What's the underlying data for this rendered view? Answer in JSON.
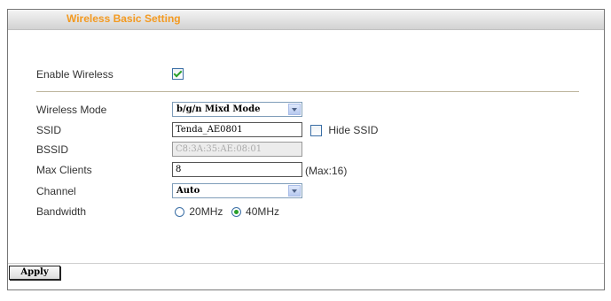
{
  "page": {
    "title": "Wireless Basic Setting"
  },
  "enable_wireless": {
    "label": "Enable Wireless",
    "checked": true
  },
  "wireless_mode": {
    "label": "Wireless Mode",
    "value": "b/g/n Mixd Mode"
  },
  "ssid": {
    "label": "SSID",
    "value": "Tenda_AE0801",
    "hide_label": "Hide SSID",
    "hide_checked": false
  },
  "bssid": {
    "label": "BSSID",
    "value": "C8:3A:35:AE:08:01"
  },
  "max_clients": {
    "label": "Max Clients",
    "value": "8",
    "hint": "(Max:16)"
  },
  "channel": {
    "label": "Channel",
    "value": "Auto"
  },
  "bandwidth": {
    "label": "Bandwidth",
    "options": [
      "20MHz",
      "40MHz"
    ],
    "selected": "40MHz"
  },
  "apply_label": "Apply",
  "colors": {
    "title": "#f39a21",
    "check": "#2aa02a"
  }
}
